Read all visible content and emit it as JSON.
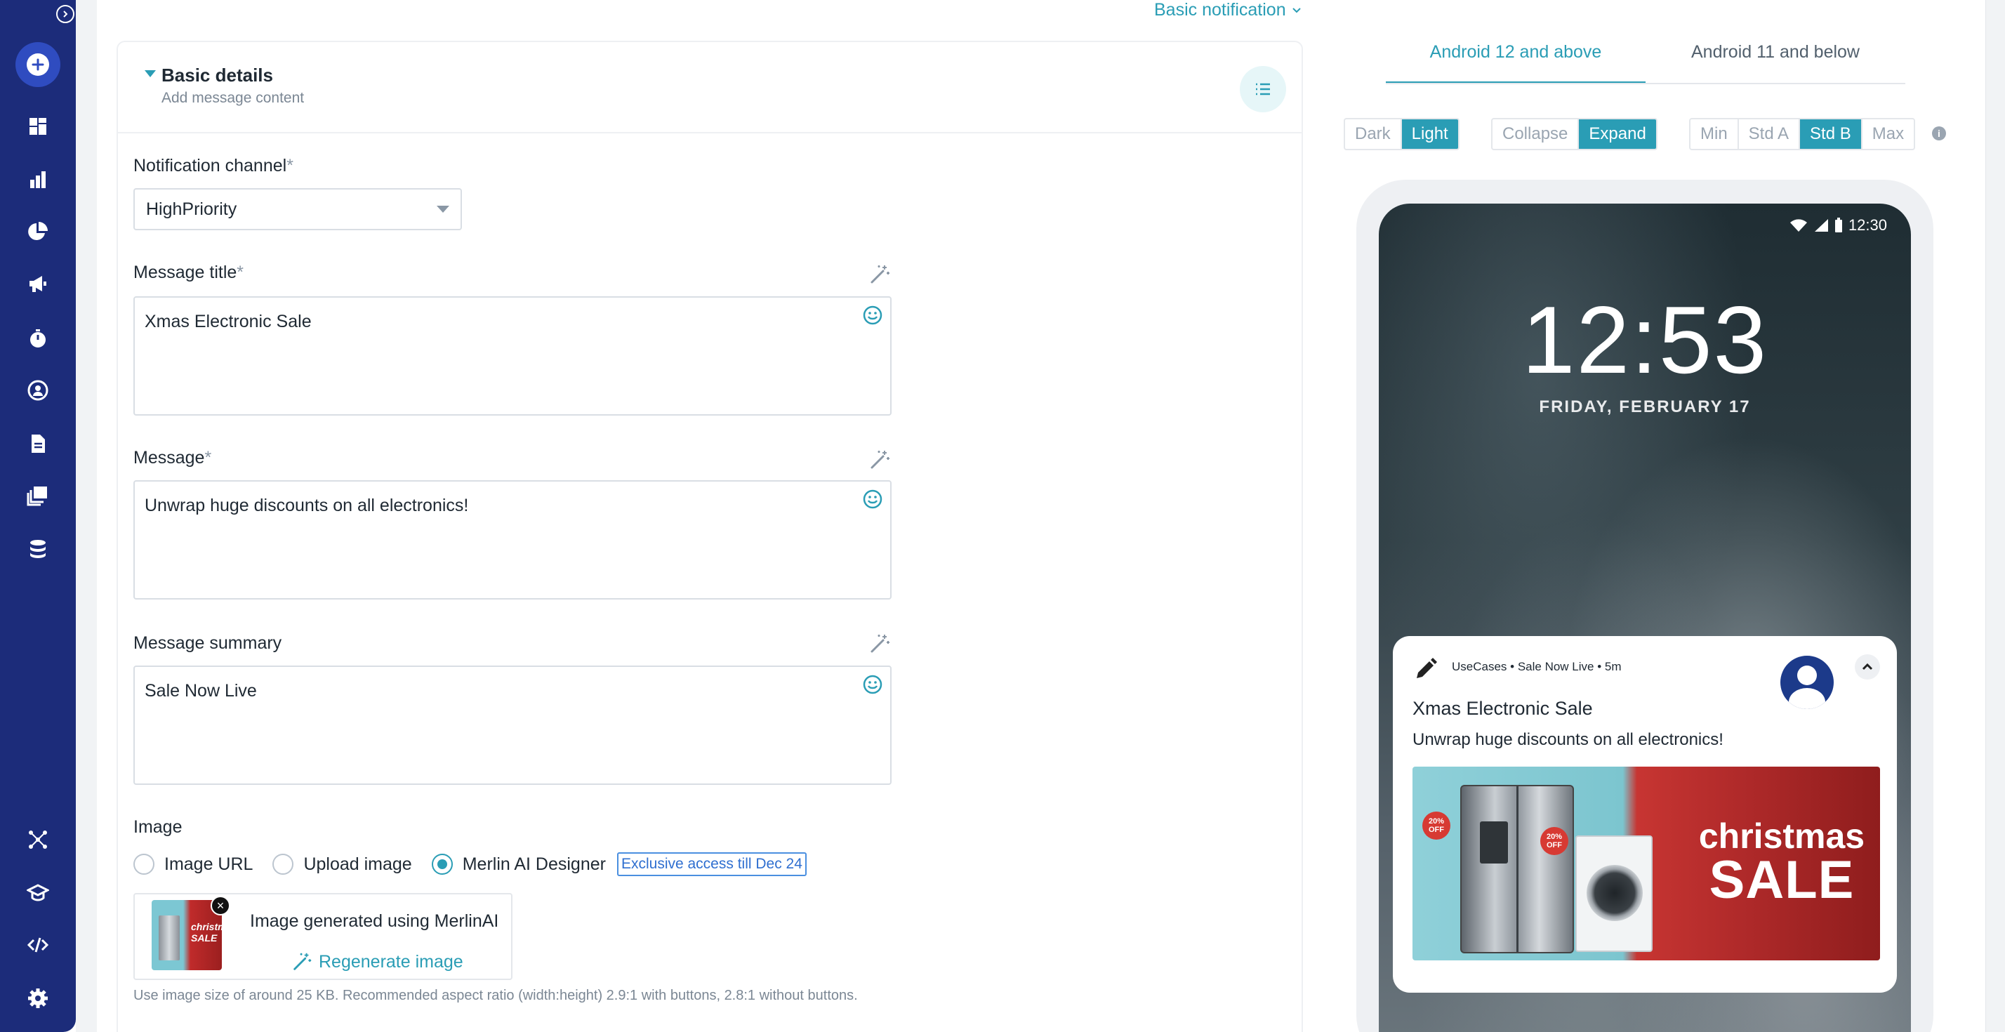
{
  "top_link": {
    "label": "Basic notification"
  },
  "section": {
    "title": "Basic details",
    "subtitle": "Add message content"
  },
  "fields": {
    "channel_label": "Notification channel",
    "channel_required": "*",
    "channel_value": "HighPriority",
    "title_label": "Message title",
    "title_required": "*",
    "title_value": "Xmas Electronic Sale",
    "message_label": "Message",
    "message_required": "*",
    "message_value": "Unwrap huge discounts on all electronics!",
    "summary_label": "Message summary",
    "summary_value": "Sale Now Live"
  },
  "image": {
    "label": "Image",
    "options": [
      "Image URL",
      "Upload image",
      "Merlin AI Designer"
    ],
    "selected": "Merlin AI Designer",
    "badge": "Exclusive access till Dec 24",
    "generated_text": "Image generated using MerlinAI",
    "regenerate_label": "Regenerate image",
    "hint": "Use image size of around 25 KB. Recommended aspect ratio (width:height) 2.9:1 with buttons, 2.8:1 without buttons."
  },
  "preview": {
    "tabs": [
      "Android 12 and above",
      "Android 11 and below"
    ],
    "active_tab": "Android 12 and above",
    "theme_options": [
      "Dark",
      "Light"
    ],
    "theme_selected": "Light",
    "view_options": [
      "Collapse",
      "Expand"
    ],
    "view_selected": "Expand",
    "size_options": [
      "Min",
      "Std A",
      "Std B",
      "Max"
    ],
    "size_selected": "Std B"
  },
  "phone": {
    "status_time": "12:30",
    "clock": "12:53",
    "date": "FRIDAY, FEBRUARY 17",
    "notification": {
      "meta": "UseCases • Sale Now Live • 5m",
      "title": "Xmas Electronic Sale",
      "message": "Unwrap huge discounts on all electronics!",
      "image_text_line1": "christmas",
      "image_text_line2": "SALE",
      "tag_text": "20% OFF"
    }
  },
  "thumb_text": {
    "line1": "christmas",
    "line2": "SALE"
  },
  "colors": {
    "sidebar": "#1c2c7a",
    "accent": "#2a9db5",
    "badge_blue": "#2f6fd0"
  }
}
